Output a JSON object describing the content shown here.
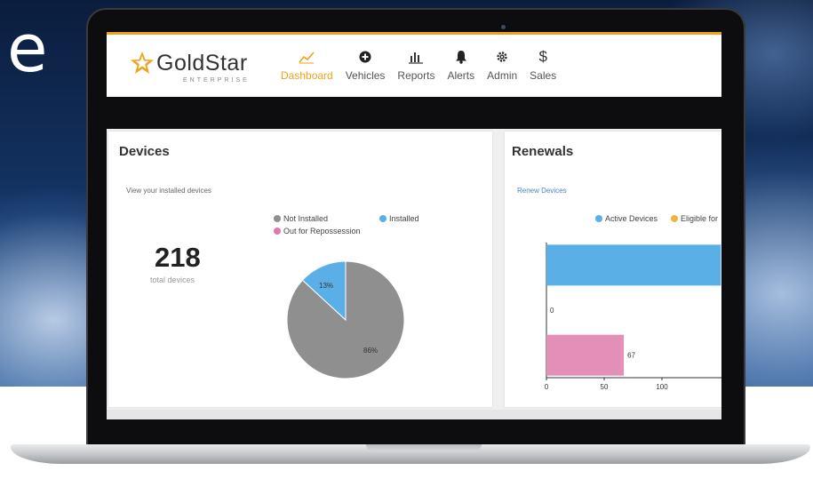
{
  "background_letter": "e",
  "brand": {
    "name": "GoldStar",
    "sub": "ENTERPRISE",
    "accent": "#f0a21a"
  },
  "nav": [
    {
      "label": "Dashboard",
      "icon": "chart-line-icon",
      "active": true
    },
    {
      "label": "Vehicles",
      "icon": "plus-circle-icon"
    },
    {
      "label": "Reports",
      "icon": "bar-chart-icon"
    },
    {
      "label": "Alerts",
      "icon": "bell-icon"
    },
    {
      "label": "Admin",
      "icon": "gear-icon"
    },
    {
      "label": "Sales",
      "icon": "dollar-icon"
    }
  ],
  "devices": {
    "title": "Devices",
    "subtitle": "View your installed devices",
    "total": "218",
    "total_label": "total devices",
    "legend": [
      {
        "label": "Not Installed",
        "color": "#8f8f8f"
      },
      {
        "label": "Installed",
        "color": "#5ab0e6"
      },
      {
        "label": "Out for Repossession",
        "color": "#e07aa8"
      }
    ]
  },
  "renewals": {
    "title": "Renewals",
    "subtitle": "Renew Devices",
    "legend": [
      {
        "label": "Active Devices",
        "color": "#5ab0e6"
      },
      {
        "label": "Eligible for",
        "color": "#f0b43c"
      }
    ]
  },
  "chart_data": [
    {
      "type": "pie",
      "categories": [
        "Not Installed",
        "Installed",
        "Out for Repossession"
      ],
      "values": [
        86,
        13,
        0
      ],
      "labels": [
        "86%",
        "13%",
        ""
      ],
      "colors": [
        "#8f8f8f",
        "#5ab0e6",
        "#e07aa8"
      ],
      "legend": "top"
    },
    {
      "type": "bar",
      "orientation": "horizontal",
      "categories": [
        "",
        "",
        ""
      ],
      "series": [
        {
          "name": "Active Devices",
          "values": [
            151,
            0,
            0
          ],
          "color": "#5ab0e6"
        },
        {
          "name": "Eligible for",
          "values": [
            0,
            0,
            0
          ],
          "color": "#f0b43c"
        },
        {
          "name": "",
          "values": [
            0,
            0,
            67
          ],
          "color": "#e48fb8"
        }
      ],
      "value_labels": [
        "",
        "0",
        "67"
      ],
      "xticks": [
        "0",
        "50",
        "100"
      ],
      "xlim": [
        0,
        150
      ],
      "legend": "top"
    }
  ]
}
